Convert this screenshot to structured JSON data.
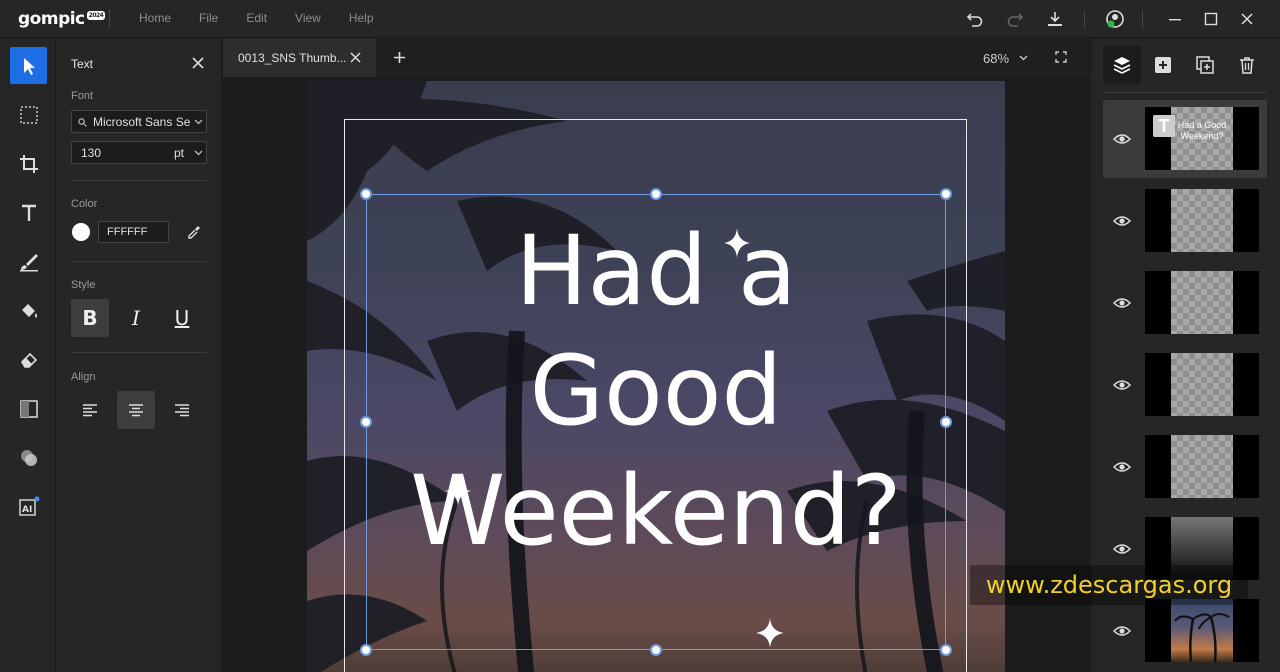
{
  "app": {
    "logo_text": "gom",
    "logo_pic": "pic",
    "logo_badge": "2024",
    "menu": [
      "Home",
      "File",
      "Edit",
      "View",
      "Help"
    ]
  },
  "toolbar": {
    "tools": [
      "select-tool",
      "marquee-tool",
      "crop-tool",
      "text-tool",
      "brush-tool",
      "fill-tool",
      "eraser-tool",
      "gradient-tool",
      "blend-tool",
      "ai-tool"
    ],
    "active": "select-tool"
  },
  "text_panel": {
    "title": "Text",
    "font_label": "Font",
    "font_value": "Microsoft Sans Se",
    "size_value": "130",
    "size_unit": "pt",
    "color_label": "Color",
    "color_hex": "FFFFFF",
    "color_swatch": "#ffffff",
    "style_label": "Style",
    "bold": "B",
    "italic": "I",
    "underline": "U",
    "align_label": "Align",
    "align_active": "center"
  },
  "tabs": {
    "active_label": "0013_SNS Thumb...",
    "zoom": "68%"
  },
  "canvas": {
    "line1": "Had a",
    "line2": "Good",
    "line3": "Weekend?"
  },
  "layers": {
    "items": [
      {
        "name": "text-layer",
        "thumb_text": "Had a Good Weekend?",
        "selected": true
      },
      {
        "name": "layer-2"
      },
      {
        "name": "layer-3"
      },
      {
        "name": "layer-4"
      },
      {
        "name": "layer-5"
      },
      {
        "name": "gradient-layer"
      },
      {
        "name": "photo-layer"
      }
    ]
  },
  "watermark": "www.zdescargas.org",
  "colors": {
    "accent": "#1e6fe6",
    "selection": "#6f9ae0",
    "watermark": "#f2d02a"
  }
}
